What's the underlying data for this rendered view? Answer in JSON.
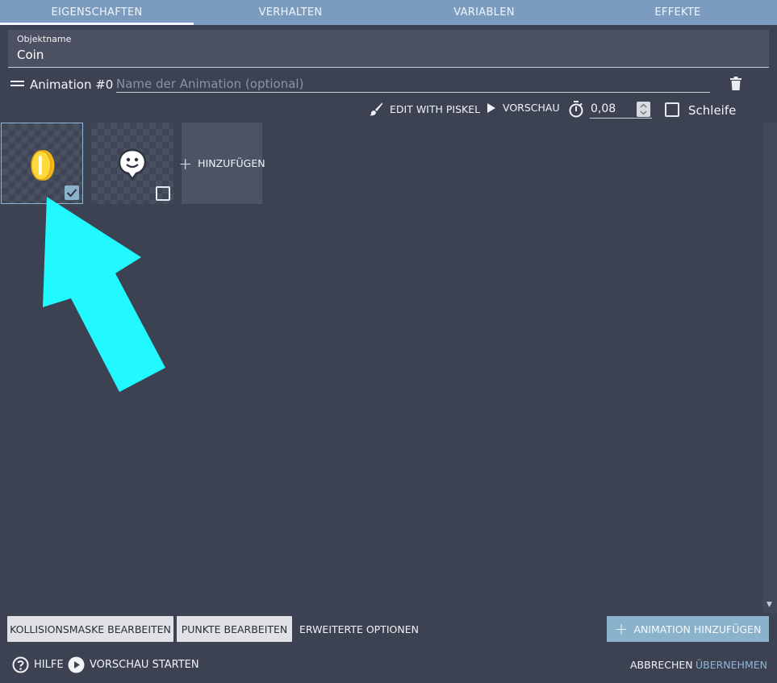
{
  "tabs": [
    {
      "label": "EIGENSCHAFTEN",
      "active": true
    },
    {
      "label": "VERHALTEN",
      "active": false
    },
    {
      "label": "VARIABLEN",
      "active": false
    },
    {
      "label": "EFFEKTE",
      "active": false
    }
  ],
  "object": {
    "name_label": "Objektname",
    "name_value": "Coin"
  },
  "animation": {
    "title": "Animation #0",
    "name_placeholder": "Name der Animation (optional)",
    "name_value": ""
  },
  "toolbar": {
    "edit_pixel_label": "EDIT WITH PISKEL",
    "preview_label": "VORSCHAU",
    "timing_value": "0,08",
    "loop_label": "Schleife",
    "loop_checked": false
  },
  "frames": [
    {
      "icon": "coin-sprite",
      "checked": true
    },
    {
      "icon": "smiley-sprite",
      "checked": false
    }
  ],
  "add_frame_label": "HINZUFÜGEN",
  "buttons": {
    "collision_mask": "KOLLISIONSMASKE BEARBEITEN",
    "edit_points": "PUNKTE BEARBEITEN",
    "advanced_options": "ERWEITERTE OPTIONEN",
    "add_animation": "ANIMATION HINZUFÜGEN"
  },
  "footer": {
    "help": "HILFE",
    "preview_start": "VORSCHAU STARTEN",
    "cancel": "ABBRECHEN",
    "apply": "ÜBERNEHMEN"
  },
  "colors": {
    "accent": "#8ab2cb",
    "tabs_bg": "#7c9cbf",
    "panel_bg": "#3c4252",
    "arrow": "#22f8ff"
  }
}
